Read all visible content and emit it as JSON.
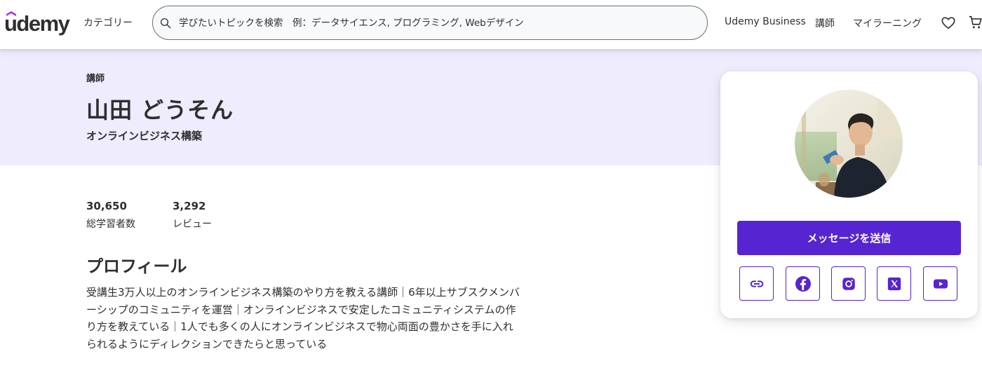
{
  "header": {
    "logo": "udemy",
    "categories": "カテゴリー",
    "search_placeholder": "学びたいトピックを検索　例：データサイエンス, プログラミング, Webデザイン",
    "nav": {
      "business": "Udemy Business",
      "instructor": "講師",
      "my_learning": "マイラーニング"
    },
    "icons": [
      "search-icon",
      "heart-icon",
      "cart-icon"
    ]
  },
  "instructor": {
    "role_label": "講師",
    "name": "山田 どうそん",
    "headline": "オンラインビジネス構築"
  },
  "stats": [
    {
      "value": "30,650",
      "label": "総学習者数"
    },
    {
      "value": "3,292",
      "label": "レビュー"
    }
  ],
  "profile": {
    "heading": "プロフィール",
    "body": "受講生3万人以上のオンラインビジネス構築のやり方を教える講師｜6年以上サブスクメンバーシップのコミュニティを運営｜オンラインビジネスで安定したコミュニティシステムの作り方を教えている｜1人でも多くの人にオンラインビジネスで物心両面の豊かさを手に入れられるようにディレクションできたらと思っている"
  },
  "card": {
    "message_button": "メッセージを送信",
    "social_icons": [
      "link-icon",
      "facebook-icon",
      "instagram-icon",
      "x-icon",
      "youtube-icon"
    ]
  },
  "colors": {
    "brand_purple": "#5624d0",
    "banner_bg": "#eeecfd",
    "text": "#2d2f31"
  }
}
